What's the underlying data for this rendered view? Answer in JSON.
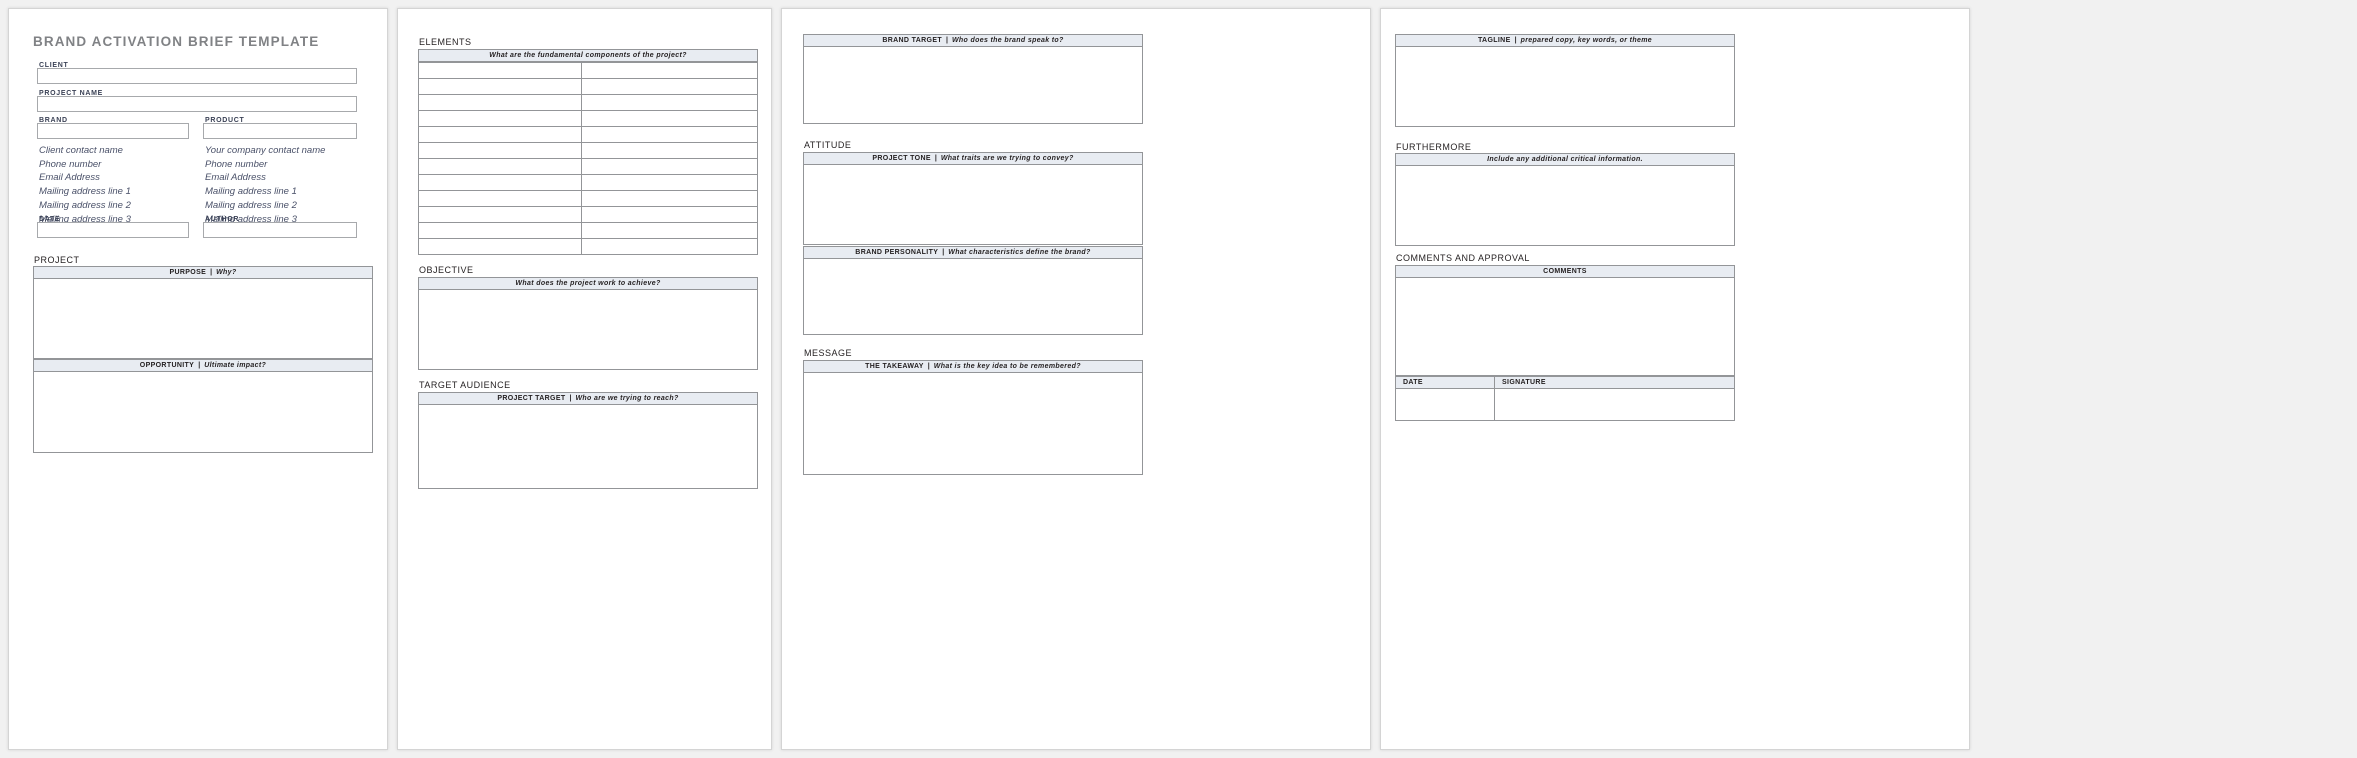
{
  "document": {
    "title": "BRAND ACTIVATION BRIEF TEMPLATE"
  },
  "colors": {
    "title_gray": "#808285",
    "header_fill": "#e8ecf2",
    "border_gray": "#939598",
    "input_border": "#a7a9ac",
    "label_navy": "#3b4256",
    "contact_italic": "#4a5169",
    "page_background": "#f1f1f1"
  },
  "page1": {
    "fields": {
      "client_label": "CLIENT",
      "client_value": "",
      "project_name_label": "PROJECT NAME",
      "project_name_value": "",
      "brand_label": "BRAND",
      "brand_value": "",
      "product_label": "PRODUCT",
      "product_value": "",
      "date_label": "DATE",
      "date_value": "",
      "author_label": "AUTHOR",
      "author_value": ""
    },
    "client_contact": [
      "Client contact name",
      "Phone number",
      "Email Address",
      "Mailing address line 1",
      "Mailing address line 2",
      "Mailing address line 3"
    ],
    "company_contact": [
      "Your company contact name",
      "Phone number",
      "Email Address",
      "Mailing address line 1",
      "Mailing address line 2",
      "Mailing address line 3"
    ],
    "project_section": {
      "label": "PROJECT",
      "purpose": {
        "title": "PURPOSE",
        "separator": "|",
        "prompt": "Why?",
        "value": ""
      },
      "opportunity": {
        "title": "OPPORTUNITY",
        "separator": "|",
        "prompt": "Ultimate impact?",
        "value": ""
      }
    }
  },
  "page2": {
    "elements_section": {
      "label": "ELEMENTS",
      "header": "What are the fundamental components of the project?",
      "row_count": 12,
      "rows": [
        [
          "",
          ""
        ],
        [
          "",
          ""
        ],
        [
          "",
          ""
        ],
        [
          "",
          ""
        ],
        [
          "",
          ""
        ],
        [
          "",
          ""
        ],
        [
          "",
          ""
        ],
        [
          "",
          ""
        ],
        [
          "",
          ""
        ],
        [
          "",
          ""
        ],
        [
          "",
          ""
        ],
        [
          "",
          ""
        ]
      ]
    },
    "objective_section": {
      "label": "OBJECTIVE",
      "header": "What does the project work to achieve?",
      "value": ""
    },
    "target_audience_section": {
      "label": "TARGET AUDIENCE",
      "title": "PROJECT TARGET",
      "separator": "|",
      "prompt": "Who are we trying to reach?",
      "value": ""
    }
  },
  "page3": {
    "brand_target": {
      "title": "BRAND TARGET",
      "separator": "|",
      "prompt": "Who does the brand speak to?",
      "value": ""
    },
    "attitude_section": {
      "label": "ATTITUDE",
      "project_tone": {
        "title": "PROJECT TONE",
        "separator": "|",
        "prompt": "What traits are we trying to convey?",
        "value": ""
      },
      "brand_personality": {
        "title": "BRAND PERSONALITY",
        "separator": "|",
        "prompt": "What characteristics define the brand?",
        "value": ""
      }
    },
    "message_section": {
      "label": "MESSAGE",
      "takeaway": {
        "title": "THE TAKEAWAY",
        "separator": "|",
        "prompt": "What is the key idea to be remembered?",
        "value": ""
      }
    }
  },
  "page4": {
    "tagline": {
      "title": "TAGLINE",
      "separator": "|",
      "prompt": "prepared copy, key words, or theme",
      "value": ""
    },
    "furthermore_section": {
      "label": "FURTHERMORE",
      "header": "Include any additional critical information.",
      "value": ""
    },
    "comments_section": {
      "label": "COMMENTS AND APPROVAL",
      "header": "COMMENTS",
      "value": "",
      "date_label": "DATE",
      "date_value": "",
      "signature_label": "SIGNATURE",
      "signature_value": ""
    }
  }
}
